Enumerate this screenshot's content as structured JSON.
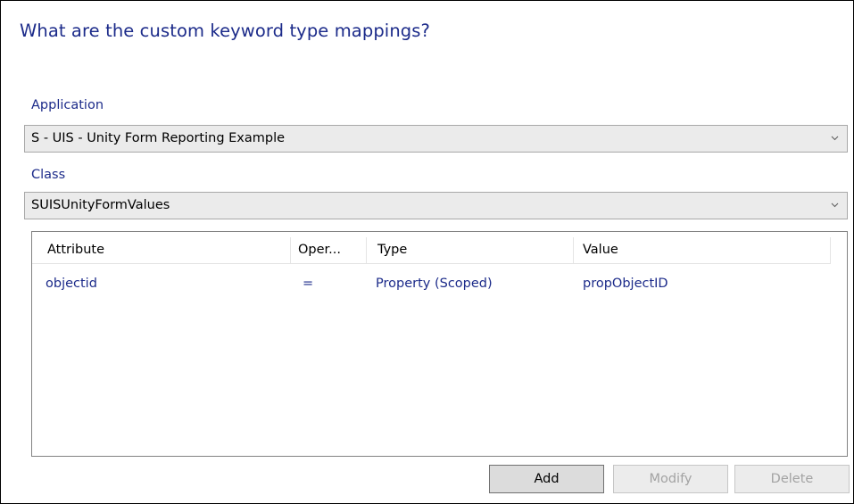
{
  "dialog": {
    "title": "What are the custom keyword type mappings?"
  },
  "application": {
    "label": "Application",
    "selected": "S - UIS - Unity Form Reporting Example"
  },
  "class": {
    "label": "Class",
    "selected": "SUISUnityFormValues"
  },
  "grid": {
    "columns": [
      "Attribute",
      "Oper...",
      "Type",
      "Value"
    ],
    "rows": [
      {
        "attribute": "objectid",
        "operator": "=",
        "type": "Property (Scoped)",
        "value": "propObjectID"
      }
    ]
  },
  "buttons": {
    "add": "Add",
    "modify": "Modify",
    "delete": "Delete"
  },
  "colors": {
    "title_text": "#1c2b8a",
    "label_text": "#1c2b8a",
    "combo_background": "#ebebeb",
    "disabled_text": "#a3a3a3"
  },
  "icons": {
    "combo_arrow": "chevron-down-icon"
  }
}
